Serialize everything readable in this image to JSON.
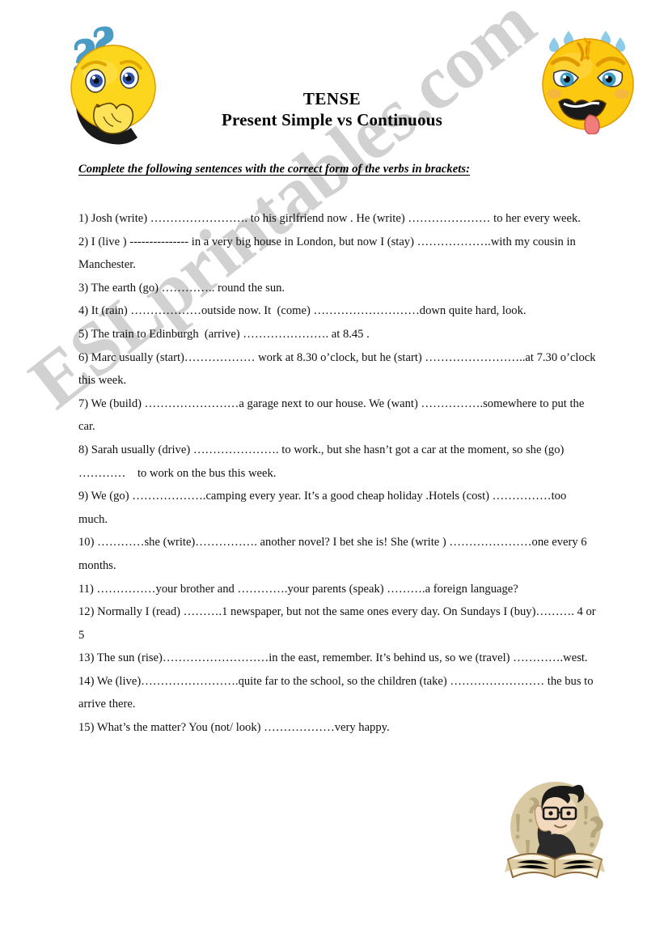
{
  "document": {
    "title_line_1": "TENSE",
    "title_line_2": "Present Simple vs Continuous",
    "instruction": "Complete the following sentences with the correct form of the verbs in brackets:",
    "watermark": "ESLprintables.com"
  },
  "artwork": {
    "thinking_face_label": "thinking-confused-smiley",
    "stressed_face_label": "stressed-exhausted-smiley",
    "teacher_logo_label": "teacher-with-book-logo"
  },
  "colors": {
    "smiley_yellow": "#fcd61c",
    "smiley_yellow_dark": "#f0a400",
    "question_mark_blue": "#4b9cc4",
    "sweat_blue": "#8ecbe8",
    "tongue_pink": "#f07c7c",
    "logo_beige": "#d9c9a3",
    "hair_black": "#1a1a1a",
    "text_black": "#000000",
    "watermark_gray": "#c9c9c9"
  },
  "exercises": [
    "1) Josh (write) ……………………. to his girlfriend now . He (write) ………………… to her every week.",
    "2) I (live ) --------------- in a very big house in London, but now I (stay) ……………….with my cousin in Manchester.",
    "3) The earth (go) ………….. round the sun.",
    "4) It (rain) ………………outside now. It  (come) ………………………down quite hard, look.",
    "5) The train to Edinburgh  (arrive) …………………. at 8.45 .",
    "6) Marc usually (start)……………… work at 8.30 o’clock, but he (start) ……………………..at 7.30 o’clock this week.",
    "7) We (build) ……………………a garage next to our house. We (want) …………….somewhere to put the car.",
    "8) Sarah usually (drive) …………………. to work., but she hasn’t got a car at the moment, so she (go) …………    to work on the bus this week.",
    "9) We (go) ……………….camping every year. It’s a good cheap holiday .Hotels (cost) ……………too much.",
    "10) …………she (write)……………. another novel? I bet she is! She (write ) …………………one every 6 months.",
    "11) ……………your brother and ………….your parents (speak) ……….a foreign language?",
    "12) Normally I (read) ……….1 newspaper, but not the same ones every day. On Sundays I (buy)………. 4 or 5",
    "13) The sun (rise)………………………in the east, remember. It’s behind us, so we (travel) ………….west.",
    "14) We (live)…………………….quite far to the school, so the children (take) …………………… the bus to arrive there.",
    "15) What’s the matter? You (not/ look) ………………very happy."
  ]
}
